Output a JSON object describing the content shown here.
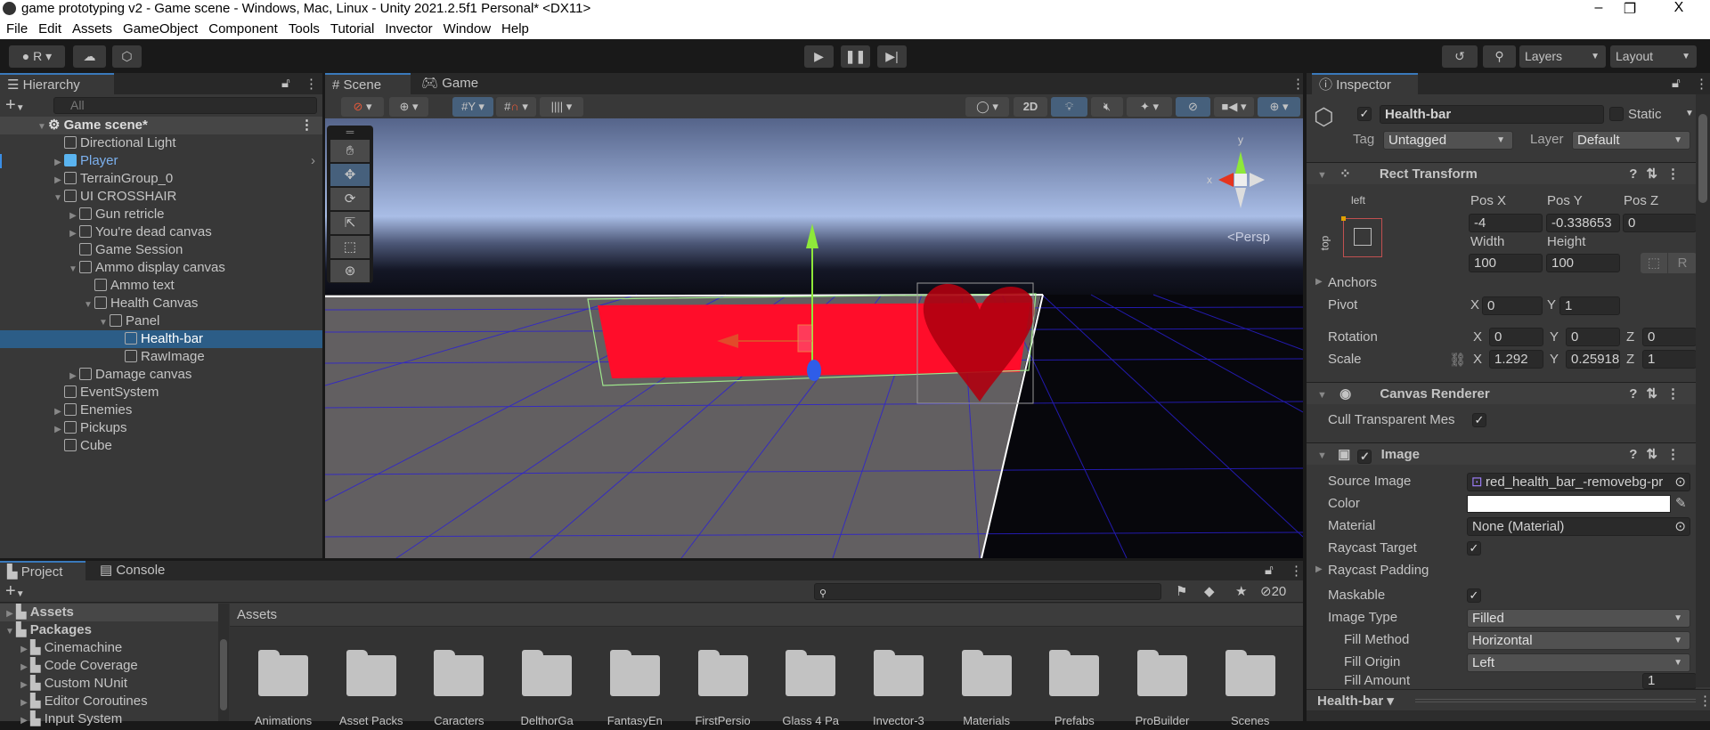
{
  "window": {
    "title": "game prototyping v2 - Game scene - Windows, Mac, Linux - Unity 2021.2.5f1 Personal* <DX11>",
    "minimize": "–",
    "restore": "❐",
    "close": "X"
  },
  "menu": [
    "File",
    "Edit",
    "Assets",
    "GameObject",
    "Component",
    "Tools",
    "Tutorial",
    "Invector",
    "Window",
    "Help"
  ],
  "toolbar": {
    "account": "R",
    "layers": "Layers",
    "layout": "Layout"
  },
  "hierarchy": {
    "tab": "Hierarchy",
    "search_placeholder": "All",
    "scene": "Game scene*",
    "items": [
      {
        "label": "Directional Light",
        "depth": 0,
        "arrow": ""
      },
      {
        "label": "Player",
        "depth": 0,
        "arrow": "▶",
        "prefab": true
      },
      {
        "label": "TerrainGroup_0",
        "depth": 0,
        "arrow": "▶"
      },
      {
        "label": "UI CROSSHAIR",
        "depth": 0,
        "arrow": "▼"
      },
      {
        "label": "Gun retricle",
        "depth": 1,
        "arrow": "▶"
      },
      {
        "label": "You're dead canvas",
        "depth": 1,
        "arrow": "▶"
      },
      {
        "label": "Game Session",
        "depth": 1,
        "arrow": ""
      },
      {
        "label": "Ammo display canvas",
        "depth": 1,
        "arrow": "▼"
      },
      {
        "label": "Ammo text",
        "depth": 2,
        "arrow": ""
      },
      {
        "label": "Health Canvas",
        "depth": 2,
        "arrow": "▼"
      },
      {
        "label": "Panel",
        "depth": 3,
        "arrow": "▼"
      },
      {
        "label": "Health-bar",
        "depth": 4,
        "arrow": "",
        "selected": true
      },
      {
        "label": "RawImage",
        "depth": 4,
        "arrow": ""
      },
      {
        "label": "Damage canvas",
        "depth": 1,
        "arrow": "▶"
      },
      {
        "label": "EventSystem",
        "depth": 0,
        "arrow": ""
      },
      {
        "label": "Enemies",
        "depth": 0,
        "arrow": "▶"
      },
      {
        "label": "Pickups",
        "depth": 0,
        "arrow": "▶"
      },
      {
        "label": "Cube",
        "depth": 0,
        "arrow": ""
      }
    ]
  },
  "scene": {
    "tab_scene": "Scene",
    "tab_game": "Game",
    "btn_2d": "2D",
    "persp": "Persp",
    "axis_x": "x",
    "axis_y": "y"
  },
  "inspector": {
    "tab": "Inspector",
    "name": "Health-bar",
    "static_label": "Static",
    "tag_label": "Tag",
    "tag": "Untagged",
    "layer_label": "Layer",
    "layer": "Default",
    "rect": {
      "title": "Rect Transform",
      "anchor_h": "left",
      "anchor_v": "top",
      "posx_label": "Pos X",
      "posy_label": "Pos Y",
      "posz_label": "Pos Z",
      "posx": "-4",
      "posy": "-0.338653",
      "posz": "0",
      "width_label": "Width",
      "height_label": "Height",
      "width": "100",
      "height": "100",
      "raw_btn": "R",
      "anchors": "Anchors",
      "pivot": "Pivot",
      "pivot_x": "0",
      "pivot_y": "1",
      "rotation": "Rotation",
      "rot_x": "0",
      "rot_y": "0",
      "rot_z": "0",
      "scale": "Scale",
      "scale_x": "1.292",
      "scale_y": "0.25918",
      "scale_z": "1",
      "x": "X",
      "y": "Y",
      "z": "Z"
    },
    "canvas_renderer": {
      "title": "Canvas Renderer",
      "cull": "Cull Transparent Mes"
    },
    "image": {
      "title": "Image",
      "source_image_label": "Source Image",
      "source_image": "red_health_bar_-removebg-pr",
      "color_label": "Color",
      "color": "#ffffff",
      "material_label": "Material",
      "material": "None (Material)",
      "raycast_target": "Raycast Target",
      "raycast_padding": "Raycast Padding",
      "maskable": "Maskable",
      "image_type_label": "Image Type",
      "image_type": "Filled",
      "fill_method_label": "Fill Method",
      "fill_method": "Horizontal",
      "fill_origin_label": "Fill Origin",
      "fill_origin": "Left",
      "fill_amount_label": "Fill Amount",
      "fill_amount": "1"
    },
    "footer": "Health-bar"
  },
  "project": {
    "tab_project": "Project",
    "tab_console": "Console",
    "hidden_count": "20",
    "tree": [
      {
        "label": "Assets",
        "depth": 0
      },
      {
        "label": "Packages",
        "depth": 0
      },
      {
        "label": "Cinemachine",
        "depth": 1
      },
      {
        "label": "Code Coverage",
        "depth": 1
      },
      {
        "label": "Custom NUnit",
        "depth": 1
      },
      {
        "label": "Editor Coroutines",
        "depth": 1
      },
      {
        "label": "Input System",
        "depth": 1
      }
    ],
    "breadcrumb": "Assets",
    "folders": [
      "Animations",
      "Asset Packs",
      "Caracters",
      "DelthorGa",
      "FantasyEn",
      "FirstPersio",
      "Glass 4 Pa",
      "Invector-3",
      "Materials",
      "Prefabs",
      "ProBuilder",
      "Scenes"
    ]
  }
}
